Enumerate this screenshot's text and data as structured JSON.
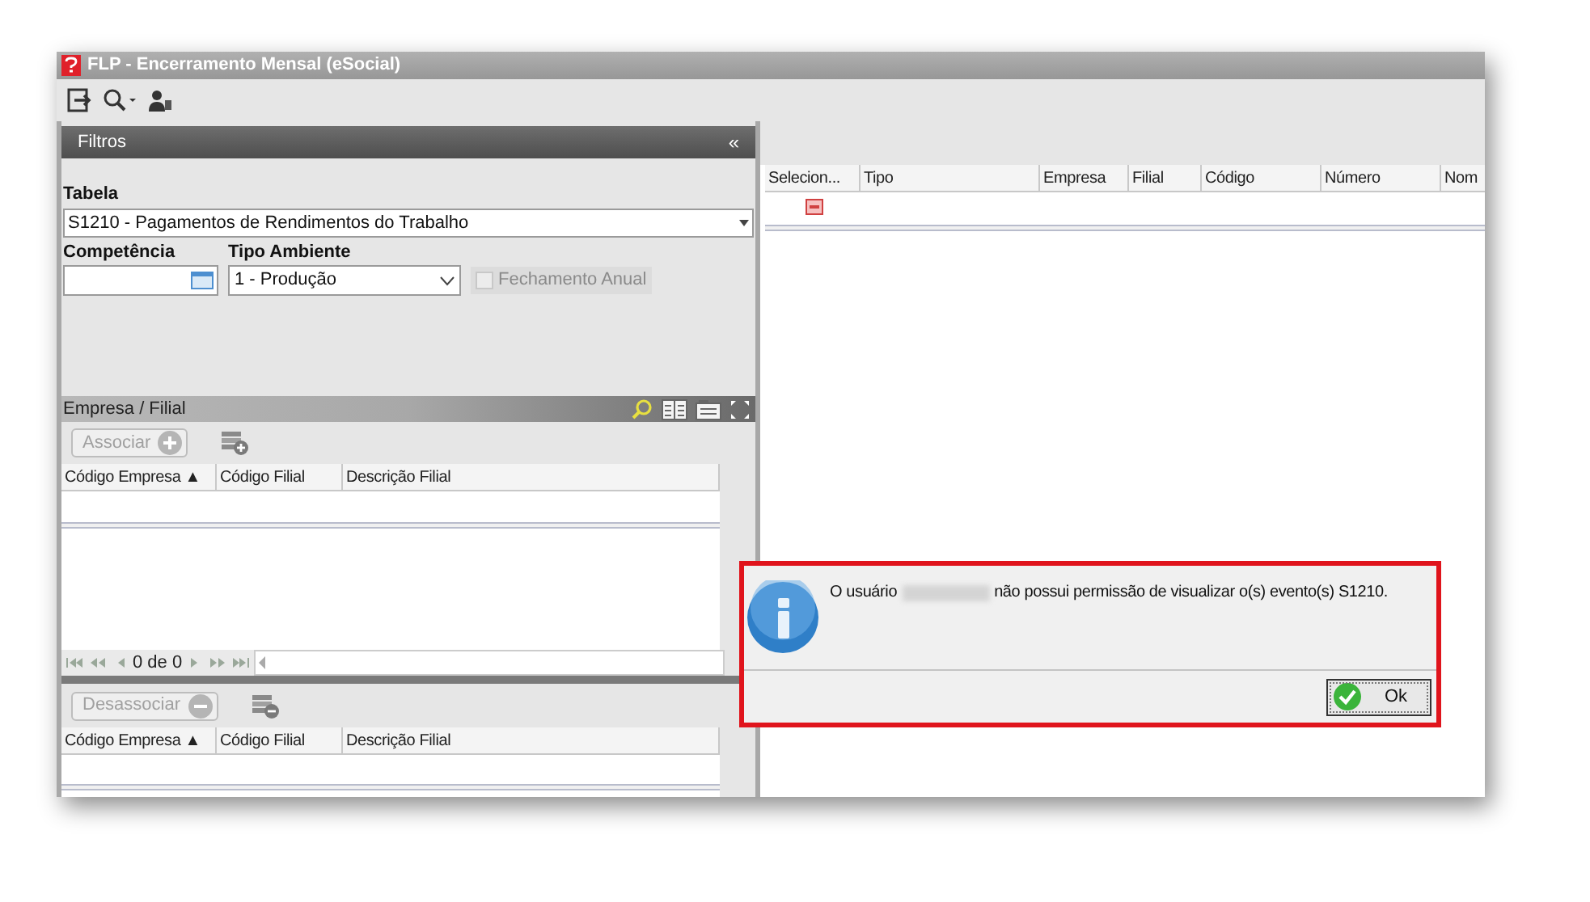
{
  "window": {
    "title": "FLP - Encerramento Mensal (eSocial)"
  },
  "filters_panel": {
    "title": "Filtros",
    "collapse": "«",
    "tabela": {
      "label": "Tabela",
      "value": "S1210 - Pagamentos de Rendimentos do Trabalho"
    },
    "competencia": {
      "label": "Competência"
    },
    "tipo_ambiente": {
      "label": "Tipo Ambiente",
      "value": "1 - Produção"
    },
    "fechamento_anual": {
      "label": "Fechamento Anual",
      "checked": false,
      "disabled": true
    }
  },
  "empresa_filial": {
    "title": "Empresa / Filial",
    "associate_button": {
      "label": "Associar",
      "disabled": true
    },
    "associated_grid": {
      "columns": [
        "Código Empresa ▲",
        "Código Filial",
        "Descrição Filial"
      ]
    },
    "pager": {
      "text": "0 de 0"
    },
    "dissociate_button": {
      "label": "Desassociar",
      "disabled": true
    },
    "available_grid": {
      "columns": [
        "Código Empresa ▲",
        "Código Filial",
        "Descrição Filial"
      ]
    }
  },
  "events_grid": {
    "columns": [
      "Selecion...",
      "Tipo",
      "Empresa",
      "Filial",
      "Código",
      "Número",
      "Nom"
    ]
  },
  "dialog": {
    "message_before": "O usuário",
    "redacted": true,
    "message_after": "não possui permissão de visualizar o(s) evento(s) S1210.",
    "ok_button": "Ok"
  }
}
